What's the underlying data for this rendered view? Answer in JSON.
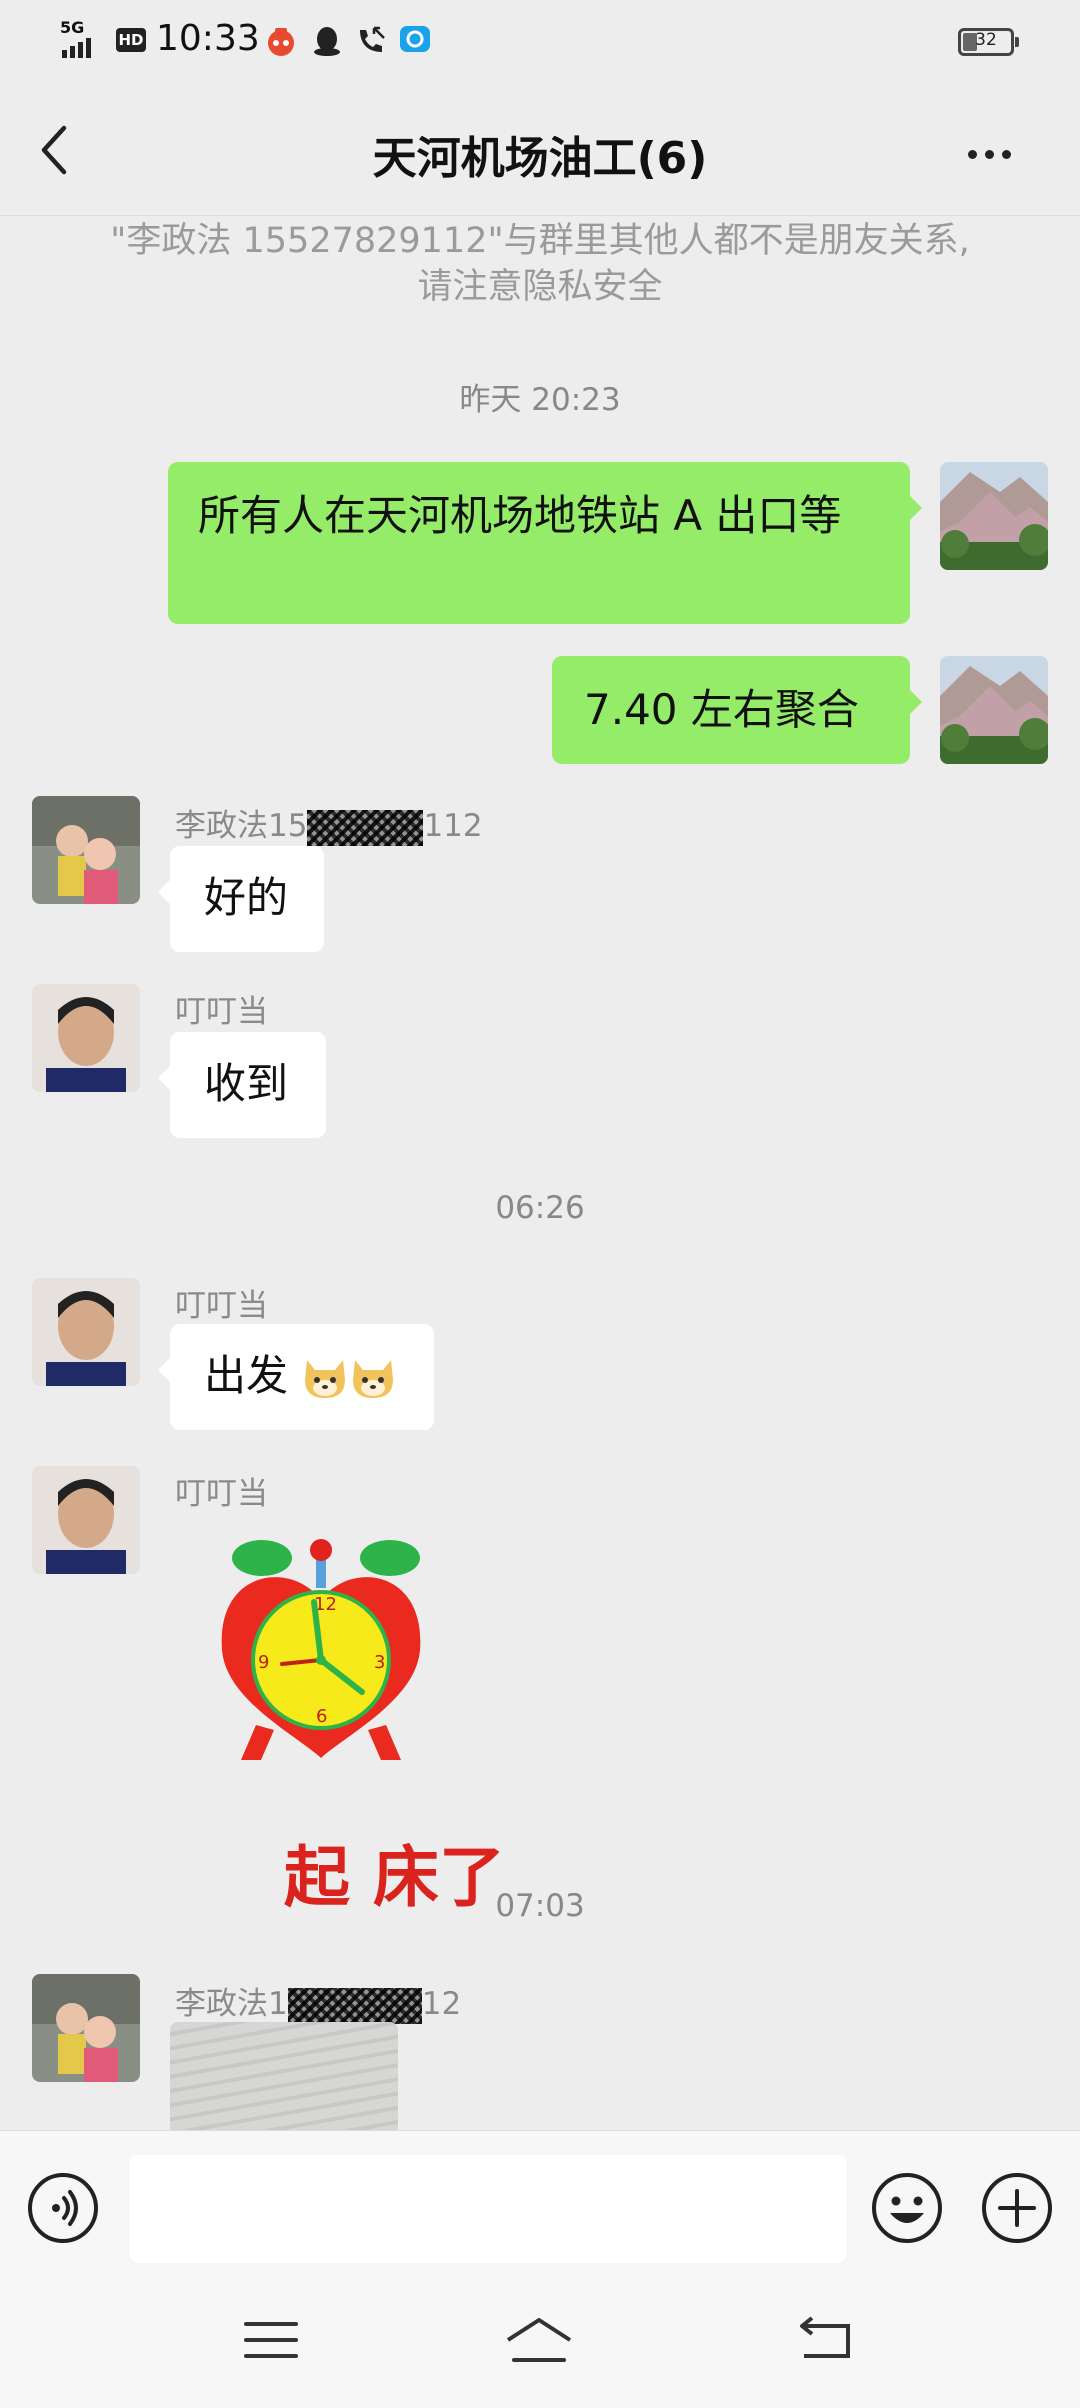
{
  "status_bar": {
    "time": "10:33",
    "network": "5G",
    "hd": "HD",
    "battery": "32"
  },
  "header": {
    "title": "天河机场油工(6)"
  },
  "notice": {
    "line1": "\"李政法 15527829112\"与群里其他人都不是朋友关系,",
    "line2": "请注意隐私安全"
  },
  "messages": {
    "ts1": "昨天 20:23",
    "m1": "所有人在天河机场地铁站 A 出口等",
    "m2": "7.40 左右聚合",
    "s3_prefix": "李政法15",
    "s3_suffix": "112",
    "m3": "好的",
    "s4": "叮叮当",
    "m4": "收到",
    "ts2": "06:26",
    "s5": "叮叮当",
    "m5": "出发",
    "s6": "叮叮当",
    "sticker_text": "起 床了",
    "ts3": "07:03",
    "s7_prefix": "李政法1",
    "s7_suffix": "12"
  },
  "colors": {
    "my_bubble": "#95ec69",
    "other_bubble": "#ffffff",
    "background": "#ededed"
  },
  "icons": {
    "back": "chevron-left-icon",
    "more": "more-horizontal-icon",
    "voice": "voice-icon",
    "emoji": "emoji-icon",
    "plus": "plus-icon"
  }
}
